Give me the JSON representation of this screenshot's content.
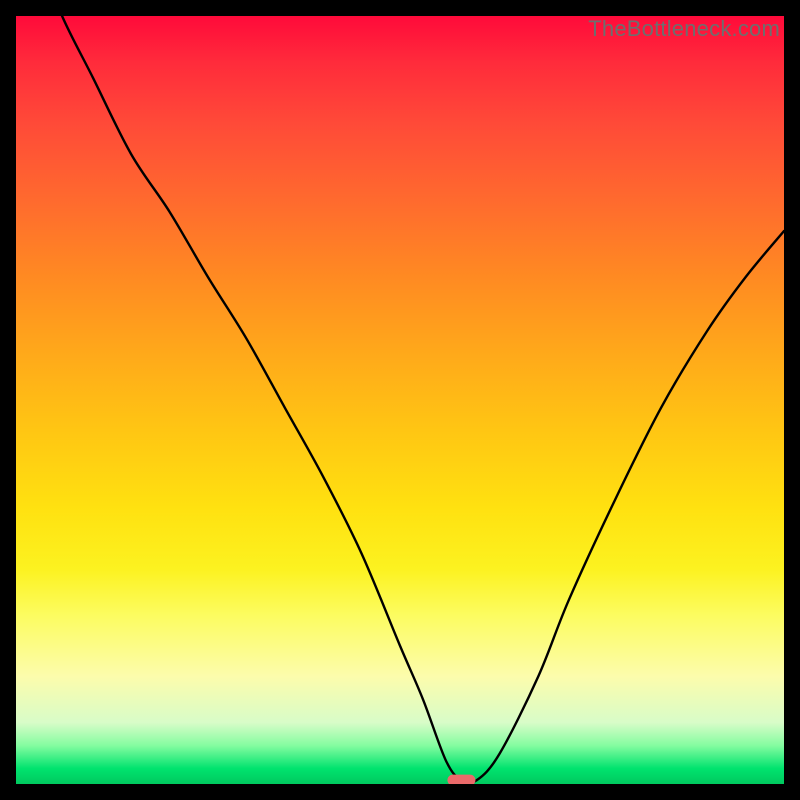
{
  "chart_data": {
    "type": "line",
    "title": "",
    "xlabel": "",
    "ylabel": "",
    "xlim": [
      0,
      100
    ],
    "ylim": [
      0,
      100
    ],
    "grid": false,
    "legend": false,
    "watermark": "TheBottleneck.com",
    "background_gradient": {
      "direction": "top-to-bottom",
      "stops": [
        {
          "pos": 0,
          "color": "#ff0a3a"
        },
        {
          "pos": 50,
          "color": "#ffcb12"
        },
        {
          "pos": 80,
          "color": "#fcfc70"
        },
        {
          "pos": 100,
          "color": "#00c95f"
        }
      ]
    },
    "marker": {
      "shape": "rounded-bar",
      "x": 58,
      "y": 0.5,
      "color": "#ea6a6a"
    },
    "series": [
      {
        "name": "bottleneck-curve",
        "x": [
          0,
          3,
          6,
          10,
          15,
          20,
          25,
          30,
          35,
          40,
          45,
          50,
          53,
          56,
          58,
          60,
          63,
          68,
          72,
          78,
          84,
          90,
          95,
          100
        ],
        "values": [
          115,
          108,
          100,
          92,
          82,
          74.5,
          66,
          58,
          49,
          40,
          30,
          18,
          11,
          3,
          0.5,
          0.5,
          4,
          14,
          24,
          37,
          49,
          59,
          66,
          72
        ]
      }
    ]
  }
}
